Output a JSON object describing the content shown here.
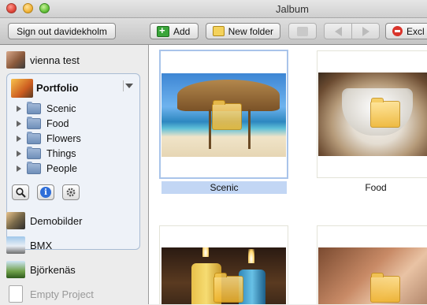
{
  "window": {
    "title": "Jalbum"
  },
  "toolbar": {
    "sign_out": "Sign out davidekholm",
    "add": "Add",
    "new_folder": "New folder",
    "exclude": "Excl"
  },
  "sidebar": {
    "top_project": "vienna test",
    "portfolio": {
      "title": "Portfolio",
      "folders": [
        "Scenic",
        "Food",
        "Flowers",
        "Things",
        "People"
      ]
    },
    "projects": [
      "Demobilder",
      "BMX",
      "Björkenäs",
      "Empty Project"
    ]
  },
  "grid": {
    "items": [
      {
        "caption": "Scenic",
        "selected": true
      },
      {
        "caption": "Food",
        "selected": false
      },
      {
        "caption": "",
        "selected": false
      },
      {
        "caption": "",
        "selected": false
      }
    ]
  },
  "colors": {
    "selection": "#c2d6f4",
    "accent": "#2f6ed8"
  }
}
